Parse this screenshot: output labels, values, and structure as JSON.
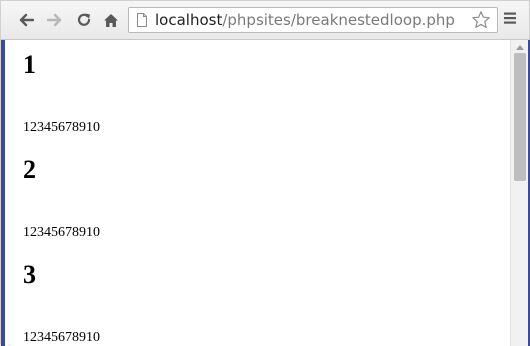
{
  "address_bar": {
    "host": "localhost",
    "path": "/phpsites/breaknestedloop.php"
  },
  "icons": {
    "back": "back-arrow-icon",
    "forward": "forward-arrow-icon",
    "reload": "reload-icon",
    "home": "home-icon",
    "page": "page-icon",
    "bookmark": "star-icon",
    "menu": "hamburger-menu-icon"
  },
  "page": {
    "blocks": [
      {
        "heading": "1",
        "sequence": "12345678910"
      },
      {
        "heading": "2",
        "sequence": "12345678910"
      },
      {
        "heading": "3",
        "sequence": "12345678910"
      }
    ]
  }
}
